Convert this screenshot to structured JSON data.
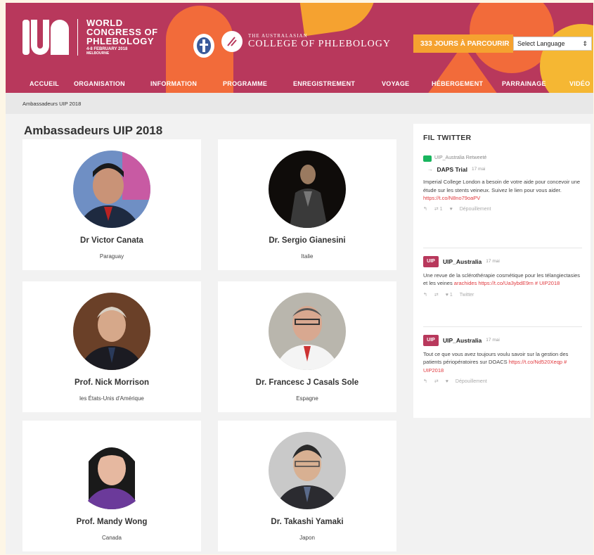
{
  "header": {
    "logo_line1": "WORLD",
    "logo_line2": "CONGRESS OF",
    "logo_line3": "PHLEBOLOGY",
    "logo_date": "4-8 FEBRUARY 2018",
    "logo_city": "MELBOURNE",
    "college_small": "THE AUSTRALASIAN",
    "college_big": "COLLEGE OF PHLEBOLOGY",
    "countdown": "333 JOURS À PARCOURIR",
    "language": "Select Language",
    "colors": {
      "brand": "#b8385c",
      "orange": "#f26b3a",
      "yellow": "#f5a230"
    }
  },
  "nav": [
    "ACCUEIL",
    "ORGANISATION",
    "INFORMATION",
    "PROGRAMME",
    "ENREGISTREMENT",
    "VOYAGE",
    "HÉBERGEMENT",
    "PARRAINAGE",
    "VIDÉO"
  ],
  "breadcrumb": "Ambassadeurs UIP 2018",
  "page_title": "Ambassadeurs UIP 2018",
  "ambassadors": [
    {
      "name": "Dr Victor Canata",
      "country": "Paraguay"
    },
    {
      "name": "Dr. Sergio Gianesini",
      "country": "Italie"
    },
    {
      "name": "Prof. Nick Morrison",
      "country": "les États-Unis d'Amérique"
    },
    {
      "name": "Dr. Francesc J Casals Sole",
      "country": "Espagne"
    },
    {
      "name": "Prof. Mandy Wong",
      "country": "Canada"
    },
    {
      "name": "Dr. Takashi Yamaki",
      "country": "Japon"
    }
  ],
  "twitter": {
    "title": "FIL TWITTER",
    "tweets": [
      {
        "retweet_label": "UIP_Australia Retweeté",
        "author": "DAPS Trial",
        "time": "17 mai",
        "body": "Imperial College London a besoin de votre aide pour concevoir une étude sur les stents veineux. Suivez le lien pour vous aider.",
        "link": "https://t.co/N8no79oaPV",
        "actions": [
          "↰",
          "⇄ 1",
          "♥",
          "Dépouillement"
        ]
      },
      {
        "author": "UIP_Australia",
        "time": "17 mai",
        "body": "Une revue de la sclérothérapie cosmétique pour les télangiectasies et les veines",
        "link_pre": "arachides",
        "link": "https://t.co/Ua3ybdE9rn # UIP2018",
        "actions": [
          "↰",
          "⇄",
          "♥ 1",
          "Twitter"
        ]
      },
      {
        "author": "UIP_Australia",
        "time": "17 mai",
        "body": "Tout ce que vous avez toujours voulu savoir sur la gestion des patients périopératoires sur DOACS",
        "link": "https://t.co/Nd520Xeqp # UIP2018",
        "actions": [
          "↰",
          "⇄",
          "♥",
          "Dépouillement"
        ]
      }
    ]
  }
}
